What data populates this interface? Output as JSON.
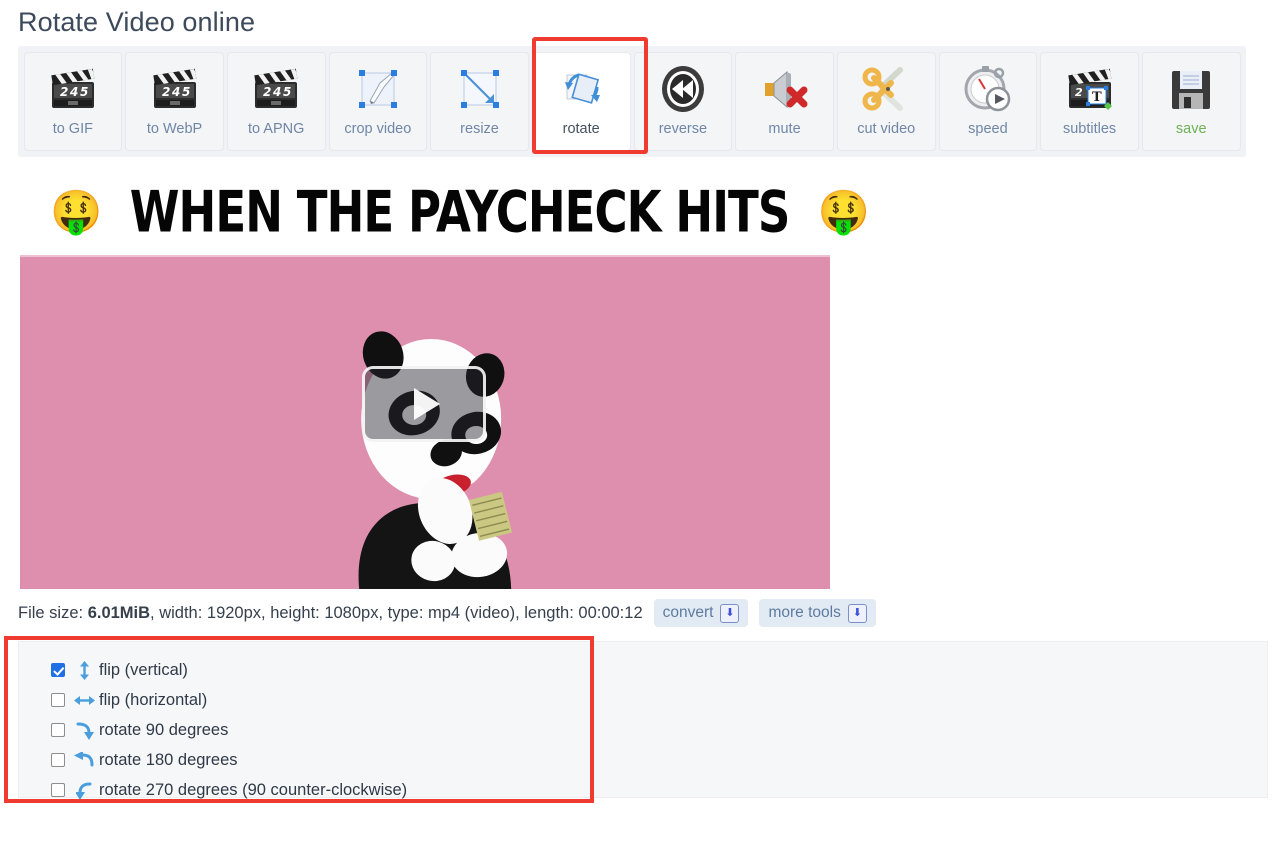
{
  "page": {
    "title": "Rotate Video online"
  },
  "toolbar": {
    "items": [
      {
        "label": "to GIF",
        "icon": "clapperboard-icon",
        "active": false
      },
      {
        "label": "to WebP",
        "icon": "clapperboard-icon",
        "active": false
      },
      {
        "label": "to APNG",
        "icon": "clapperboard-icon",
        "active": false
      },
      {
        "label": "crop video",
        "icon": "crop-pen-icon",
        "active": false
      },
      {
        "label": "resize",
        "icon": "resize-handles-icon",
        "active": false
      },
      {
        "label": "rotate",
        "icon": "rotate-pages-icon",
        "active": true
      },
      {
        "label": "reverse",
        "icon": "rewind-icon",
        "active": false
      },
      {
        "label": "mute",
        "icon": "speaker-mute-icon",
        "active": false
      },
      {
        "label": "cut video",
        "icon": "scissors-icon",
        "active": false
      },
      {
        "label": "speed",
        "icon": "stopwatch-play-icon",
        "active": false
      },
      {
        "label": "subtitles",
        "icon": "clapperboard-text-icon",
        "active": false
      },
      {
        "label": "save",
        "icon": "floppy-disk-icon",
        "active": false
      }
    ],
    "highlighted_item": "rotate"
  },
  "meme": {
    "left_emoji": "🤑",
    "right_emoji": "🤑",
    "caption": "WHEN THE PAYCHECK HITS"
  },
  "video": {
    "play_button_label": "play",
    "background_color": "#dd8fad"
  },
  "fileinfo": {
    "prefix": "File size: ",
    "size": "6.01MiB",
    "rest": ", width: 1920px, height: 1080px, type: mp4 (video), length: 00:00:12",
    "convert_label": "convert",
    "more_tools_label": "more tools",
    "badge_glyph": "⬇"
  },
  "options": {
    "rows": [
      {
        "label": "flip (vertical)",
        "checked": true,
        "icon": "arrow-up-down-icon"
      },
      {
        "label": "flip (horizontal)",
        "checked": false,
        "icon": "arrow-left-right-icon"
      },
      {
        "label": "rotate 90 degrees",
        "checked": false,
        "icon": "curved-arrow-down-right-icon"
      },
      {
        "label": "rotate 180 degrees",
        "checked": false,
        "icon": "curved-arrow-left-icon"
      },
      {
        "label": "rotate 270 degrees (90 counter-clockwise)",
        "checked": false,
        "icon": "curved-arrow-down-left-icon"
      }
    ]
  },
  "colors": {
    "highlight_red": "#f03b30",
    "save_green": "#6fb053",
    "tool_label_blue": "#6f86a6",
    "checkbox_blue": "#1f6fe5",
    "icon_blue": "#4a9ede"
  }
}
